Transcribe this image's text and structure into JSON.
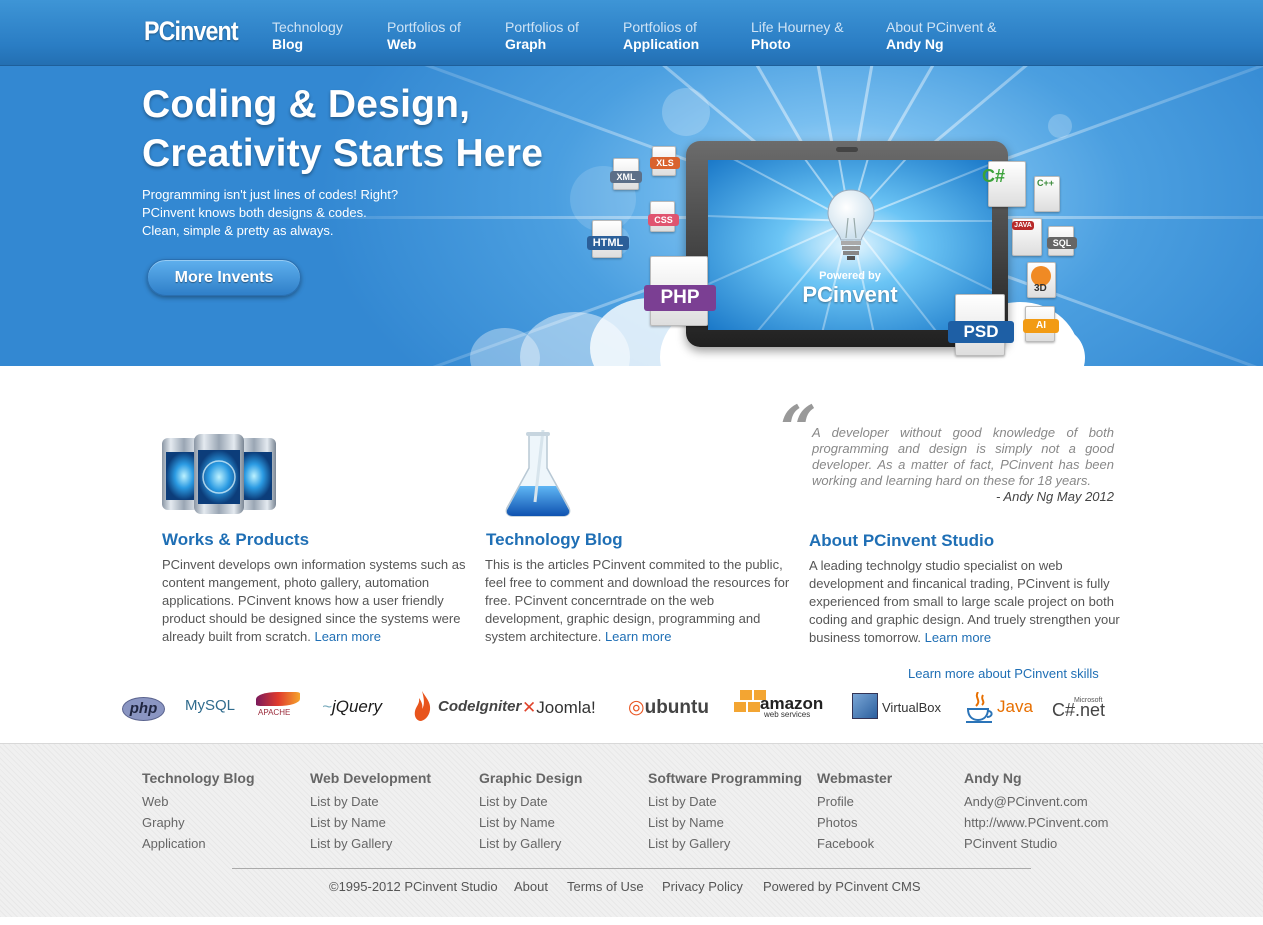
{
  "brand": {
    "logo": "PCinvent"
  },
  "nav": [
    {
      "line1": "Technology",
      "line2": "Blog"
    },
    {
      "line1": "Portfolios of",
      "line2": "Web"
    },
    {
      "line1": "Portfolios of",
      "line2": "Graph"
    },
    {
      "line1": "Portfolios of",
      "line2": "Application"
    },
    {
      "line1": "Life Hourney &",
      "line2": "Photo"
    },
    {
      "line1": "About PCinvent &",
      "line2": "Andy Ng"
    }
  ],
  "hero": {
    "title_line1": "Coding & Design,",
    "title_line2": "Creativity Starts Here",
    "text_line1": "Programming isn't just lines of codes! Right?",
    "text_line2": "PCinvent knows both designs & codes.",
    "text_line3": "Clean, simple & pretty as always.",
    "button": "More Invents",
    "powered_by": "Powered by",
    "powered_brand": "PCinvent",
    "file_labels": {
      "xml": "XML",
      "xls": "XLS",
      "css": "CSS",
      "html": "HTML",
      "php": "PHP",
      "psd": "PSD",
      "csharp": "C#",
      "cpp": "C++",
      "java": "JAVA",
      "sql": "SQL",
      "three_d": "3D",
      "ai": "AI"
    }
  },
  "features": [
    {
      "title": "Works & Products",
      "desc": "PCinvent develops own information systems such as content mangement, photo gallery, automation applications. PCinvent knows how a user friendly product should be designed since the systems were already built from scratch.",
      "link": "Learn more"
    },
    {
      "title": "Technology Blog",
      "desc": "This is the articles PCinvent commited to the public, feel free to comment and download the resources for free. PCinvent concerntrade on the web development, graphic design, programming and system architecture.",
      "link": "Learn more"
    },
    {
      "title": "About PCinvent Studio",
      "desc": "A leading technolgy studio specialist on web development and fincanical trading, PCinvent is fully experienced from small to large scale project on both coding and graphic design. And truely strengthen your business tomorrow.",
      "link": "Learn more"
    }
  ],
  "quote": {
    "text": "A developer without good knowledge of both programming and design is simply not a good developer. As a matter of fact, PCinvent has been working and learning hard on these for 18 years.",
    "author": "- Andy Ng May 2012"
  },
  "skills_link": "Learn more about PCinvent skills",
  "tech_logos": {
    "php": "php",
    "mysql": "MySQL",
    "apache": "APACHE",
    "jquery": "jQuery",
    "codeigniter": "CodeIgniter",
    "joomla": "Joomla!",
    "ubuntu": "ubuntu",
    "amazon": "amazon",
    "amazon_sub": "web services",
    "virtualbox": "VirtualBox",
    "java": "Java",
    "microsoft": "Microsoft",
    "csharp": "C#.net"
  },
  "footer": {
    "columns": [
      {
        "title": "Technology Blog",
        "links": [
          "Web",
          "Graphy",
          "Application"
        ]
      },
      {
        "title": "Web Development",
        "links": [
          "List by Date",
          "List by Name",
          "List by Gallery"
        ]
      },
      {
        "title": "Graphic Design",
        "links": [
          "List by Date",
          "List by Name",
          "List by Gallery"
        ]
      },
      {
        "title": "Software Programming",
        "links": [
          "List by Date",
          "List by Name",
          "List by Gallery"
        ]
      },
      {
        "title": "Webmaster",
        "links": [
          "Profile",
          "Photos",
          "Facebook"
        ]
      },
      {
        "title": "Andy Ng",
        "links": [
          "Andy@PCinvent.com",
          "http://www.PCinvent.com",
          "PCinvent Studio"
        ]
      }
    ],
    "copyright": "©1995-2012 PCinvent Studio",
    "about": "About",
    "terms": "Terms of Use",
    "privacy": "Privacy Policy",
    "powered": "Powered by PCinvent CMS"
  },
  "colors": {
    "nav_blue": "#2a7dc4",
    "link_blue": "#1f6fb5",
    "hero_blue": "#3388d2",
    "footer_bg": "#f0f0f0"
  }
}
